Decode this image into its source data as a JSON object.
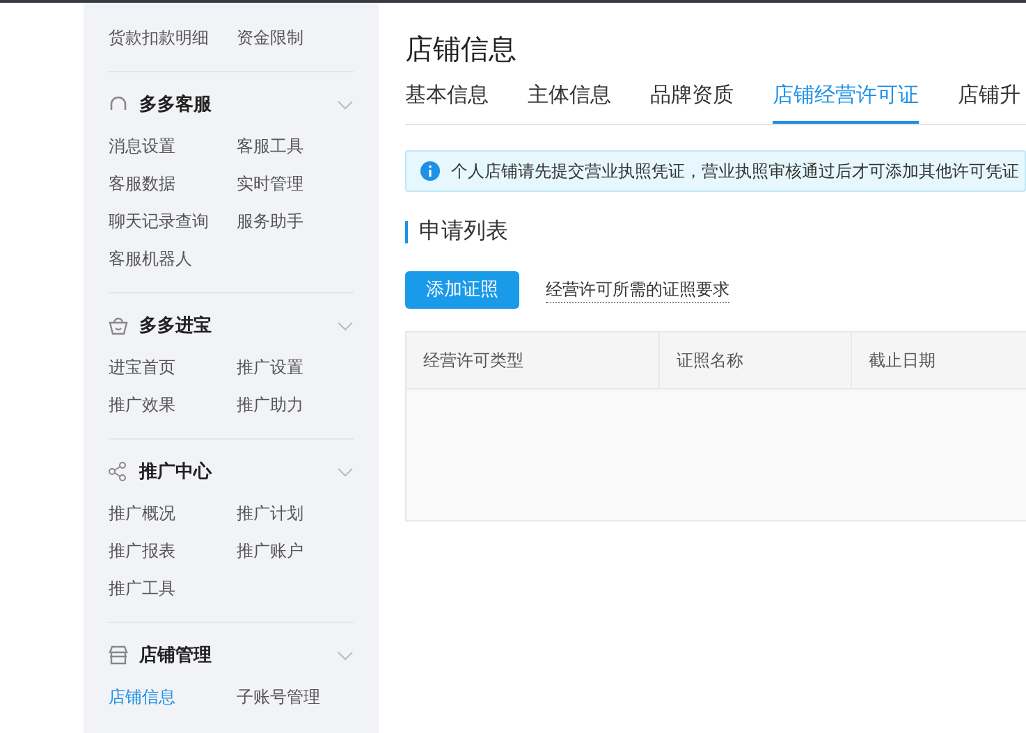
{
  "sidebar": {
    "groups": [
      {
        "items": [
          {
            "label": "货款扣款明细",
            "selected": false
          },
          {
            "label": "资金限制",
            "selected": false
          }
        ]
      },
      {
        "title": "多多客服",
        "items": [
          {
            "label": "消息设置",
            "selected": false
          },
          {
            "label": "客服工具",
            "selected": false
          },
          {
            "label": "客服数据",
            "selected": false
          },
          {
            "label": "实时管理",
            "selected": false
          },
          {
            "label": "聊天记录查询",
            "selected": false
          },
          {
            "label": "服务助手",
            "selected": false
          },
          {
            "label": "客服机器人",
            "selected": false
          }
        ]
      },
      {
        "title": "多多进宝",
        "items": [
          {
            "label": "进宝首页",
            "selected": false
          },
          {
            "label": "推广设置",
            "selected": false
          },
          {
            "label": "推广效果",
            "selected": false
          },
          {
            "label": "推广助力",
            "selected": false
          }
        ]
      },
      {
        "title": "推广中心",
        "items": [
          {
            "label": "推广概况",
            "selected": false
          },
          {
            "label": "推广计划",
            "selected": false
          },
          {
            "label": "推广报表",
            "selected": false
          },
          {
            "label": "推广账户",
            "selected": false
          },
          {
            "label": "推广工具",
            "selected": false
          }
        ]
      },
      {
        "title": "店铺管理",
        "items": [
          {
            "label": "店铺信息",
            "selected": true
          },
          {
            "label": "子账号管理",
            "selected": false
          }
        ]
      }
    ]
  },
  "page_title": "店铺信息",
  "tabs": [
    {
      "label": "基本信息",
      "selected": false
    },
    {
      "label": "主体信息",
      "selected": false
    },
    {
      "label": "品牌资质",
      "selected": false
    },
    {
      "label": "店铺经营许可证",
      "selected": true
    },
    {
      "label": "店铺升",
      "selected": false
    }
  ],
  "notice": "个人店铺请先提交营业执照凭证，营业执照审核通过后才可添加其他许可凭证",
  "section_title": "申请列表",
  "add_button": "添加证照",
  "requirements_link": "经营许可所需的证照要求",
  "table": {
    "columns": [
      "经营许可类型",
      "证照名称",
      "截止日期"
    ]
  }
}
